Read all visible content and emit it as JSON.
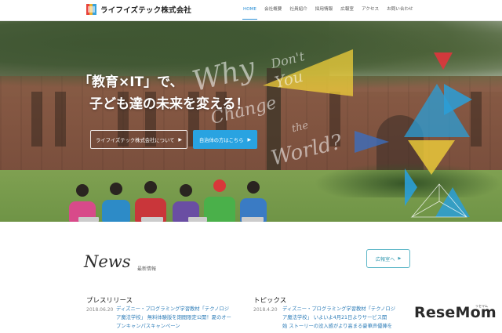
{
  "header": {
    "logo_text": "ライフイズテック株式会社",
    "nav": [
      {
        "label": "HOME",
        "active": true
      },
      {
        "label": "会社概要",
        "active": false
      },
      {
        "label": "社員紹介",
        "active": false
      },
      {
        "label": "採用情報",
        "active": false
      },
      {
        "label": "広報室",
        "active": false
      },
      {
        "label": "アクセス",
        "active": false
      },
      {
        "label": "お問い合わせ",
        "active": false
      }
    ]
  },
  "hero": {
    "headline_line1": "「教育×IT」で、",
    "headline_line2": "子ども達の未来を変える！",
    "script_words": [
      "Why",
      "Don't",
      "You",
      "Change",
      "the",
      "World?"
    ],
    "about_button": "ライフイズテック株式会社について",
    "municipality_button": "自治体の方はこちら"
  },
  "news": {
    "title": "News",
    "subtitle": "最新情報",
    "press_button": "広報室へ",
    "columns": [
      {
        "heading": "プレスリリース",
        "date": "2018.06.20",
        "text_lines": [
          "ディズニー・プログラミング学習教材「テクノロジ",
          "ア魔法学校」 無料体験版を期間限定公開！夏のオー",
          "プンキャンパスキャンペーン"
        ]
      },
      {
        "heading": "トピックス",
        "date": "2018.4.20",
        "text_lines": [
          "ディズニー・プログラミング学習教材「テクノロジ",
          "ア魔法学校」 いよいよ4月21日よりサービス開",
          "始 ストーリーの没入感がより高まる豪華声優陣を"
        ]
      }
    ]
  },
  "watermark": {
    "brand": "ReseMom",
    "small": "リセマム"
  },
  "colors": {
    "accent_blue": "#29a3e1",
    "nav_active": "#2a8fd6",
    "teal_outline": "#5bb6c7",
    "triangle_red": "#e0343c",
    "triangle_yellow": "#f0cf3a",
    "triangle_blue": "#2a9fd8"
  }
}
